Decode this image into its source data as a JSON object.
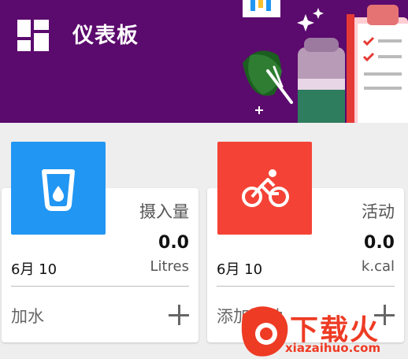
{
  "header": {
    "title": "仪表板",
    "bg": "#5b0a6d"
  },
  "cards": [
    {
      "title": "摄入量",
      "value": "0.0",
      "date": "6月 10",
      "unit": "Litres",
      "action": "加水",
      "icon": "water-glass-icon",
      "color": "#2196f3"
    },
    {
      "title": "活动",
      "value": "0.0",
      "date": "6月 10",
      "unit": "k.cal",
      "action": "添加活动",
      "icon": "bicycle-icon",
      "color": "#f44336"
    }
  ],
  "watermark": {
    "text": "下载火",
    "url": "xiazaihuo.com"
  }
}
